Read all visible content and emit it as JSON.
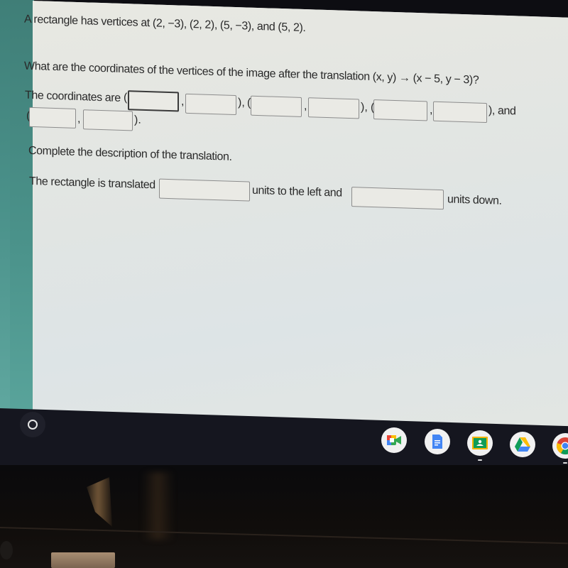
{
  "problem": {
    "statement": "A rectangle has vertices at (2, −3), (2, 2), (5, −3), and (5, 2).",
    "question": "What are the coordinates of the vertices of the image after the translation (x, y) → (x − 5, y − 3)?",
    "coordinates_prefix": "The coordinates are",
    "open_paren": "(",
    "comma": ",",
    "close_paren_comma": "),",
    "close_paren_and": "), and",
    "close_paren_period": ").",
    "vertices": [
      {
        "x_value": "",
        "y_value": ""
      },
      {
        "x_value": "",
        "y_value": ""
      },
      {
        "x_value": "",
        "y_value": ""
      },
      {
        "x_value": "",
        "y_value": ""
      }
    ],
    "description_prompt": "Complete the description of the translation.",
    "translation_prefix": "The rectangle is translated",
    "left_suffix": "units to the left and",
    "down_suffix": "units down.",
    "left_units_value": "",
    "down_units_value": ""
  },
  "shelf": {
    "launcher_icon": "launcher-circle-icon",
    "apps": [
      {
        "name": "Google Meet",
        "icon": "meet-icon"
      },
      {
        "name": "Google Docs",
        "icon": "docs-icon"
      },
      {
        "name": "Google Classroom",
        "icon": "classroom-icon"
      },
      {
        "name": "Google Drive",
        "icon": "drive-icon"
      },
      {
        "name": "Google Chrome",
        "icon": "chrome-icon"
      }
    ]
  },
  "colors": {
    "accent_teal": "#4a918a",
    "page_bg": "#e6e7e2",
    "shelf_bg": "#15161f"
  }
}
